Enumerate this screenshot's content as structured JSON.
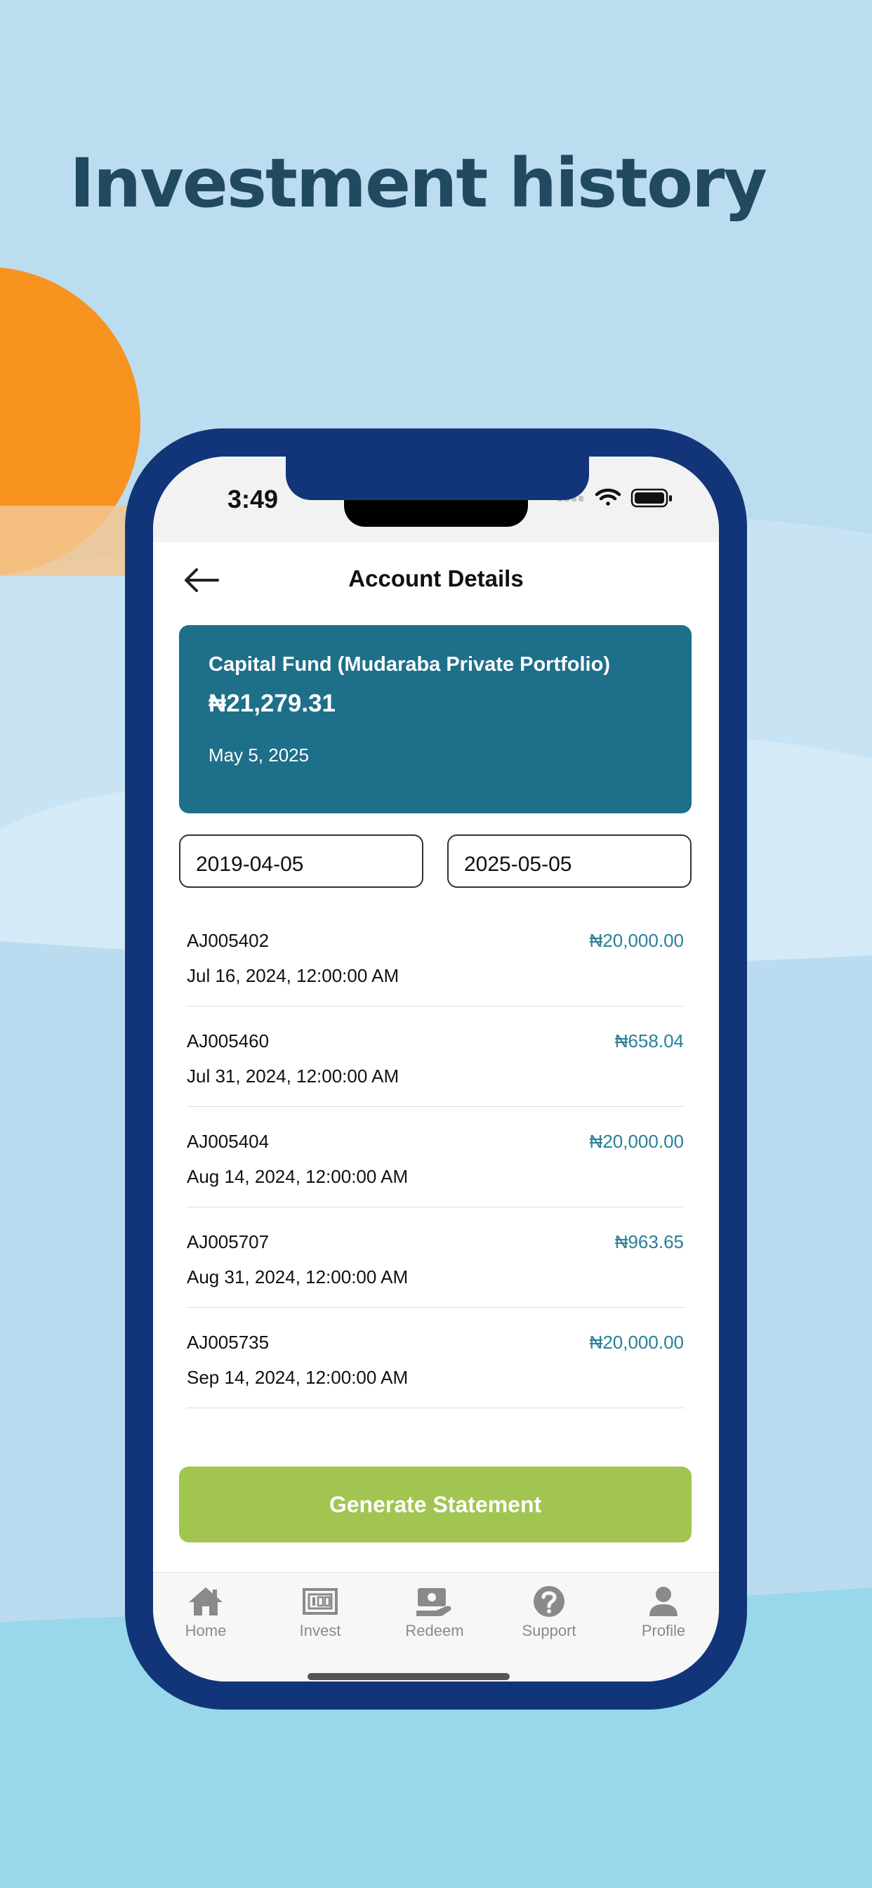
{
  "headline": "Investment history",
  "status_bar": {
    "time": "3:49"
  },
  "header": {
    "title": "Account Details"
  },
  "fund_card": {
    "name": "Capital Fund (Mudaraba Private Portfolio)",
    "amount": "₦21,279.31",
    "date": "May 5, 2025"
  },
  "date_range": {
    "from": "2019-04-05",
    "to": "2025-05-05"
  },
  "transactions": [
    {
      "id": "AJ005402",
      "date": "Jul 16, 2024, 12:00:00 AM",
      "amount": "₦20,000.00"
    },
    {
      "id": "AJ005460",
      "date": "Jul 31, 2024, 12:00:00 AM",
      "amount": "₦658.04"
    },
    {
      "id": "AJ005404",
      "date": "Aug 14, 2024, 12:00:00 AM",
      "amount": "₦20,000.00"
    },
    {
      "id": "AJ005707",
      "date": "Aug 31, 2024, 12:00:00 AM",
      "amount": "₦963.65"
    },
    {
      "id": "AJ005735",
      "date": "Sep 14, 2024, 12:00:00 AM",
      "amount": "₦20,000.00"
    }
  ],
  "generate_button": "Generate Statement",
  "tabs": [
    {
      "label": "Home",
      "icon": "home-icon"
    },
    {
      "label": "Invest",
      "icon": "banknote-icon"
    },
    {
      "label": "Redeem",
      "icon": "money-hand-icon"
    },
    {
      "label": "Support",
      "icon": "question-circle-icon"
    },
    {
      "label": "Profile",
      "icon": "person-icon"
    }
  ],
  "colors": {
    "background": "#bcdcf0",
    "headline": "#214a60",
    "phone_frame": "#12357a",
    "fund_card": "#1e6f89",
    "amount_text": "#2a7f9a",
    "generate_button": "#a1c550",
    "sun": "#f7931e"
  }
}
